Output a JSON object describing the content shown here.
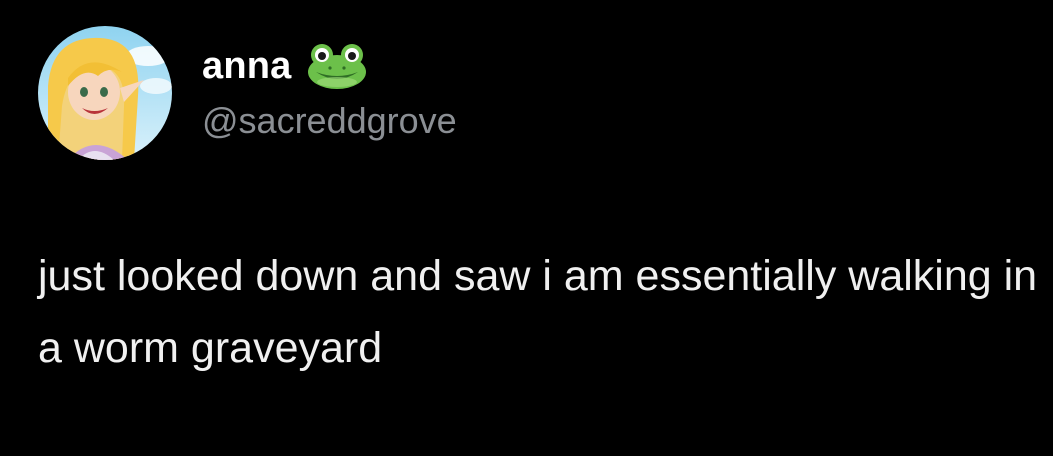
{
  "tweet": {
    "display_name": "anna",
    "name_emoji": "frog-face-emoji",
    "handle": "@sacreddgrove",
    "text": "just looked down and saw i am essentially walking in a worm graveyard"
  },
  "colors": {
    "background": "#000000",
    "name": "#ffffff",
    "handle": "#8b8f94",
    "body": "#f0f0f0"
  }
}
